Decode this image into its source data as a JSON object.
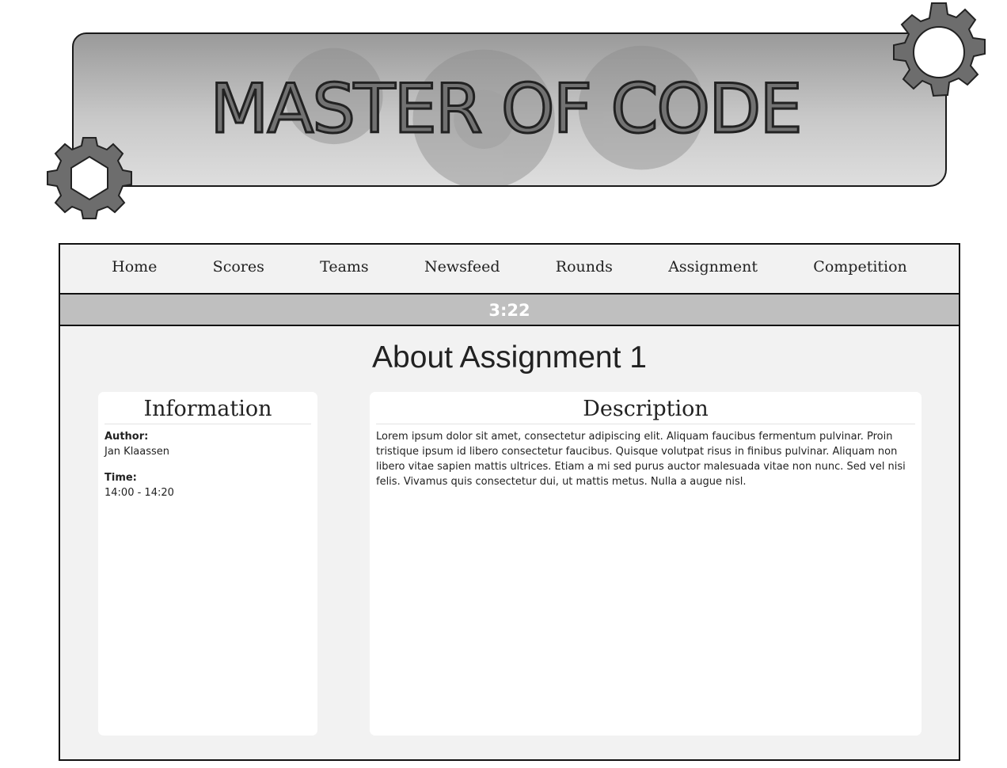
{
  "header": {
    "title": "MASTER OF CODE"
  },
  "nav": {
    "items": [
      {
        "label": "Home"
      },
      {
        "label": "Scores"
      },
      {
        "label": "Teams"
      },
      {
        "label": "Newsfeed"
      },
      {
        "label": "Rounds"
      },
      {
        "label": "Assignment"
      },
      {
        "label": "Competition"
      }
    ]
  },
  "timer": {
    "value": "3:22"
  },
  "main": {
    "title": "About Assignment 1",
    "information": {
      "heading": "Information",
      "author_label": "Author:",
      "author_value": "Jan Klaassen",
      "time_label": "Time:",
      "time_value": "14:00 - 14:20"
    },
    "description": {
      "heading": "Description",
      "text": "Lorem ipsum dolor sit amet, consectetur adipiscing elit. Aliquam faucibus fermentum pulvinar. Proin tristique ipsum id libero consectetur faucibus. Quisque volutpat risus in finibus pulvinar. Aliquam non libero vitae sapien mattis ultrices. Etiam a mi sed purus auctor malesuada vitae non nunc. Sed vel nisi felis. Vivamus quis consectetur dui, ut mattis metus. Nulla a augue nisl."
    }
  },
  "icons": {
    "top_right": "gear-icon",
    "bottom_left": "hex-nut-gear-icon",
    "banner_background": "gears-watermark"
  },
  "colors": {
    "timer_bar": "#bfbfbf",
    "frame_background": "#f2f2f2",
    "gear": "#6d6d6d"
  }
}
